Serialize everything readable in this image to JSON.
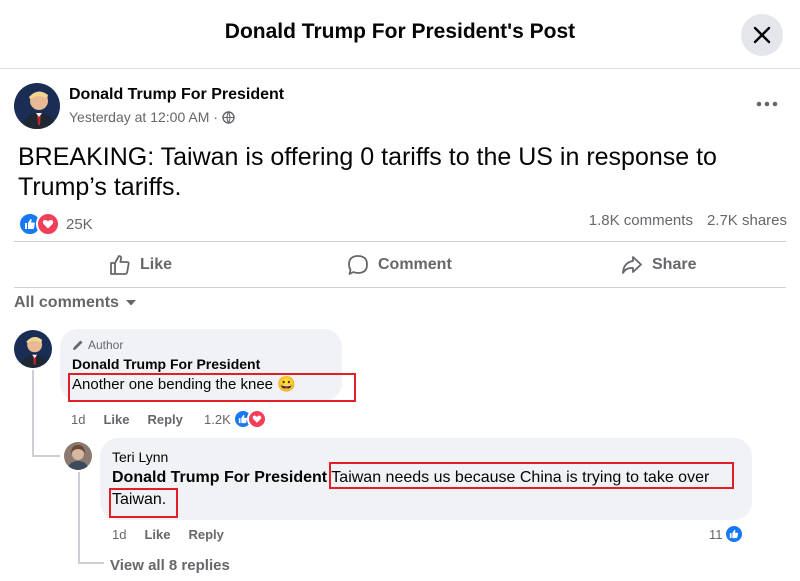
{
  "dialog": {
    "title": "Donald Trump For President's Post",
    "close_icon": "close-icon"
  },
  "post": {
    "author": "Donald Trump For President",
    "time": "Yesterday at 12:00 AM",
    "dot": "·",
    "audience_icon": "globe-icon",
    "text": "BREAKING: Taiwan is offering 0 tariffs to the US in response to Trump’s tariffs.",
    "reaction_count": "25K",
    "comments": "1.8K comments",
    "shares": "2.7K shares"
  },
  "actions": {
    "like": "Like",
    "comment": "Comment",
    "share": "Share"
  },
  "sort_label": "All comments",
  "comments": [
    {
      "badge": "Author",
      "author": "Donald Trump For President",
      "text": "Another one bending the knee 😀",
      "age": "1d",
      "like": "Like",
      "reply": "Reply",
      "reaction_count": "1.2K"
    }
  ],
  "reply": {
    "author": "Teri Lynn",
    "mention": "Donald Trump For President",
    "text": "Taiwan needs us because China is trying to take over Taiwan.",
    "age": "1d",
    "like": "Like",
    "reply": "Reply",
    "reaction_count": "11"
  },
  "view_replies": "View all 8 replies",
  "colors": {
    "like_blue": "#1877f2",
    "love_red": "#f33e58",
    "highlight": "#e41e26"
  }
}
